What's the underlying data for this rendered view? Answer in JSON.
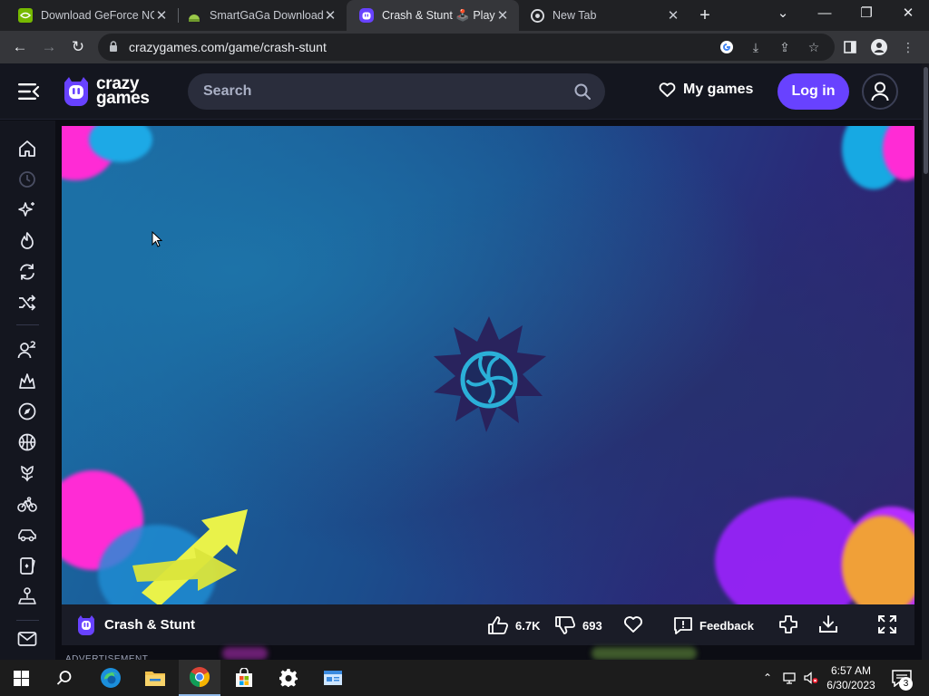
{
  "browser": {
    "tabs": [
      {
        "title": "Download GeForce NO",
        "favicon": "nvidia-icon",
        "active": false
      },
      {
        "title": "SmartGaGa Download",
        "favicon": "android-icon",
        "active": false
      },
      {
        "title": "Crash & Stunt 🕹️ Play",
        "favicon": "crazygames-icon",
        "active": true
      },
      {
        "title": "New Tab",
        "favicon": "chrome-icon",
        "active": false
      }
    ],
    "url": "crazygames.com/game/crash-stunt"
  },
  "site": {
    "logo_line1": "crazy",
    "logo_line2": "games",
    "search_placeholder": "Search",
    "mygames_label": "My games",
    "login_label": "Log in"
  },
  "sidebar": {
    "items": [
      "home-icon",
      "recent-icon",
      "new-icon",
      "trending-icon",
      "updated-icon",
      "random-icon",
      "two-player-icon",
      "action-icon",
      "adventure-icon",
      "basketball-icon",
      "beauty-icon",
      "bike-icon",
      "car-icon",
      "card-icon",
      "clicker-icon"
    ],
    "footer": "mail-icon"
  },
  "game": {
    "title": "Crash & Stunt",
    "likes": "6.7K",
    "dislikes": "693",
    "feedback_label": "Feedback",
    "below_label": "ADVERTISEMENT"
  },
  "taskbar": {
    "apps": [
      "start-icon",
      "search-icon",
      "edge-icon",
      "file-explorer-icon",
      "chrome-icon",
      "store-icon",
      "settings-icon",
      "app-icon"
    ],
    "time": "6:57 AM",
    "date": "6/30/2023",
    "notifications": "3"
  },
  "colors": {
    "accent": "#6842ff",
    "header_bg": "#14161f",
    "search_bg": "#2a2d3c"
  }
}
